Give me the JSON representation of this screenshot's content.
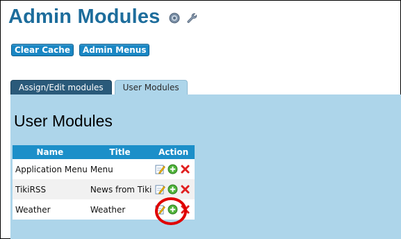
{
  "page": {
    "title": "Admin Modules"
  },
  "header_icons": {
    "help": "help-icon",
    "settings": "wrench-icon"
  },
  "toolbar": {
    "clear_cache": "Clear Cache",
    "admin_menus": "Admin Menus"
  },
  "tabs": [
    {
      "label": "Assign/Edit modules",
      "active": false
    },
    {
      "label": "User Modules",
      "active": true
    }
  ],
  "section": {
    "title": "User Modules"
  },
  "table": {
    "columns": [
      "Name",
      "Title",
      "Action"
    ],
    "rows": [
      {
        "name": "Application Menu",
        "title": "Menu",
        "actions": [
          "edit-icon",
          "add-icon",
          "delete-icon"
        ]
      },
      {
        "name": "TikiRSS",
        "title": "News from Tiki",
        "actions": [
          "edit-icon",
          "add-icon",
          "delete-icon"
        ]
      },
      {
        "name": "Weather",
        "title": "Weather",
        "actions": [
          "edit-icon",
          "add-icon",
          "delete-icon"
        ]
      }
    ]
  },
  "colors": {
    "title": "#1d6d9c",
    "button": "#1a87c4",
    "panel": "#add5ea",
    "table_header": "#1c8fc9",
    "highlight": "#e00000"
  }
}
